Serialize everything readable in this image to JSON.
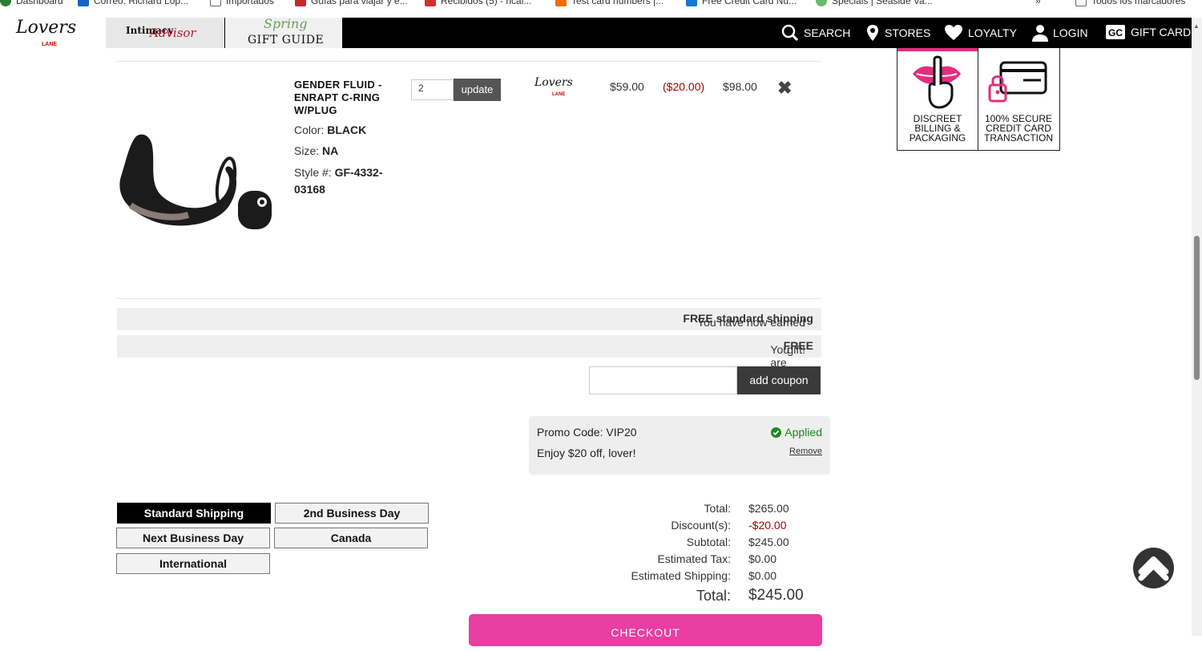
{
  "bookmarks": [
    {
      "label": "Dashboard",
      "color": "#2e7d32"
    },
    {
      "label": "Correo: Richard Lop...",
      "color": "#1565c0"
    },
    {
      "label": "Importados",
      "color": "#666666"
    },
    {
      "label": "Guías para viajar y e...",
      "color": "#c62828"
    },
    {
      "label": "Recibidos (5) - rical...",
      "color": "#d32f2f"
    },
    {
      "label": "Test card numbers |...",
      "color": "#ef6c00"
    },
    {
      "label": "Free Credit Card Nu...",
      "color": "#1976d2"
    },
    {
      "label": "Specials | Seaside Va...",
      "color": "#66bb6a"
    },
    {
      "label": "Todos los marcadores",
      "color": "#666666"
    }
  ],
  "header": {
    "logo_text": "Lovers",
    "logo_sub": "LANE",
    "tile1": {
      "line1": "Intimacy",
      "line2": "Advisor"
    },
    "tile2": {
      "line1": "Spring",
      "line2": "GIFT GUIDE"
    },
    "nav": [
      {
        "label": "SEARCH",
        "icon": "search-icon"
      },
      {
        "label": "STORES",
        "icon": "location-pin-icon"
      },
      {
        "label": "LOYALTY",
        "icon": "heart-icon"
      },
      {
        "label": "LOGIN",
        "icon": "user-icon"
      },
      {
        "label": "GIFT CARD",
        "icon": "gift-card-icon"
      }
    ]
  },
  "badges": [
    {
      "lines": [
        "DISCREET",
        "BILLING &",
        "PACKAGING"
      ],
      "icon": "lips-finger-icon"
    },
    {
      "lines": [
        "100% SECURE",
        "CREDIT CARD",
        "TRANSACTION"
      ],
      "icon": "secure-card-icon"
    }
  ],
  "cart_item": {
    "name": "GENDER FLUID - ENRAPT C-RING W/PLUG",
    "color_label": "Color:",
    "color_value": "BLACK",
    "size_label": "Size:",
    "size_value": "NA",
    "style_label": "Style #:",
    "style_value_1": "GF-4332-",
    "style_value_2": "03168",
    "quantity": "2",
    "update_label": "update",
    "brand": "Lovers",
    "brand_sub": "LANE",
    "unit_price": "$59.00",
    "discount": "($20.00)",
    "line_total": "$98.00"
  },
  "messages": {
    "shipping_pre": "You have now earned ",
    "shipping_bold": "FREE standard shipping",
    "shipping_post": "!",
    "gift_pre": "You are eligible for a ",
    "gift_bold": "FREE",
    "gift_post": " gift!"
  },
  "coupon": {
    "value": "",
    "button_label": "add coupon"
  },
  "promo": {
    "code_line": "Promo Code: VIP20",
    "description": "Enjoy $20 off, lover!",
    "status": "Applied",
    "remove_label": "Remove"
  },
  "shipping_options": [
    {
      "label": "Standard Shipping",
      "selected": true
    },
    {
      "label": "2nd Business Day",
      "selected": false
    },
    {
      "label": "Next Business Day",
      "selected": false
    },
    {
      "label": "Canada",
      "selected": false
    },
    {
      "label": "International",
      "selected": false
    }
  ],
  "totals": {
    "total_label": "Total:",
    "total_value": "$265.00",
    "discount_label": "Discount(s):",
    "discount_value": "-$20.00",
    "subtotal_label": "Subtotal:",
    "subtotal_value": "$245.00",
    "tax_label": "Estimated Tax:",
    "tax_value": "$0.00",
    "shipping_label": "Estimated Shipping:",
    "shipping_value": "$0.00",
    "grand_label": "Total:",
    "grand_value": "$245.00"
  },
  "checkout_label": "CHECKOUT",
  "colors": {
    "accent_pink": "#e93ea2",
    "discount_red": "#aa0000",
    "applied_green": "#1d8a1d"
  }
}
